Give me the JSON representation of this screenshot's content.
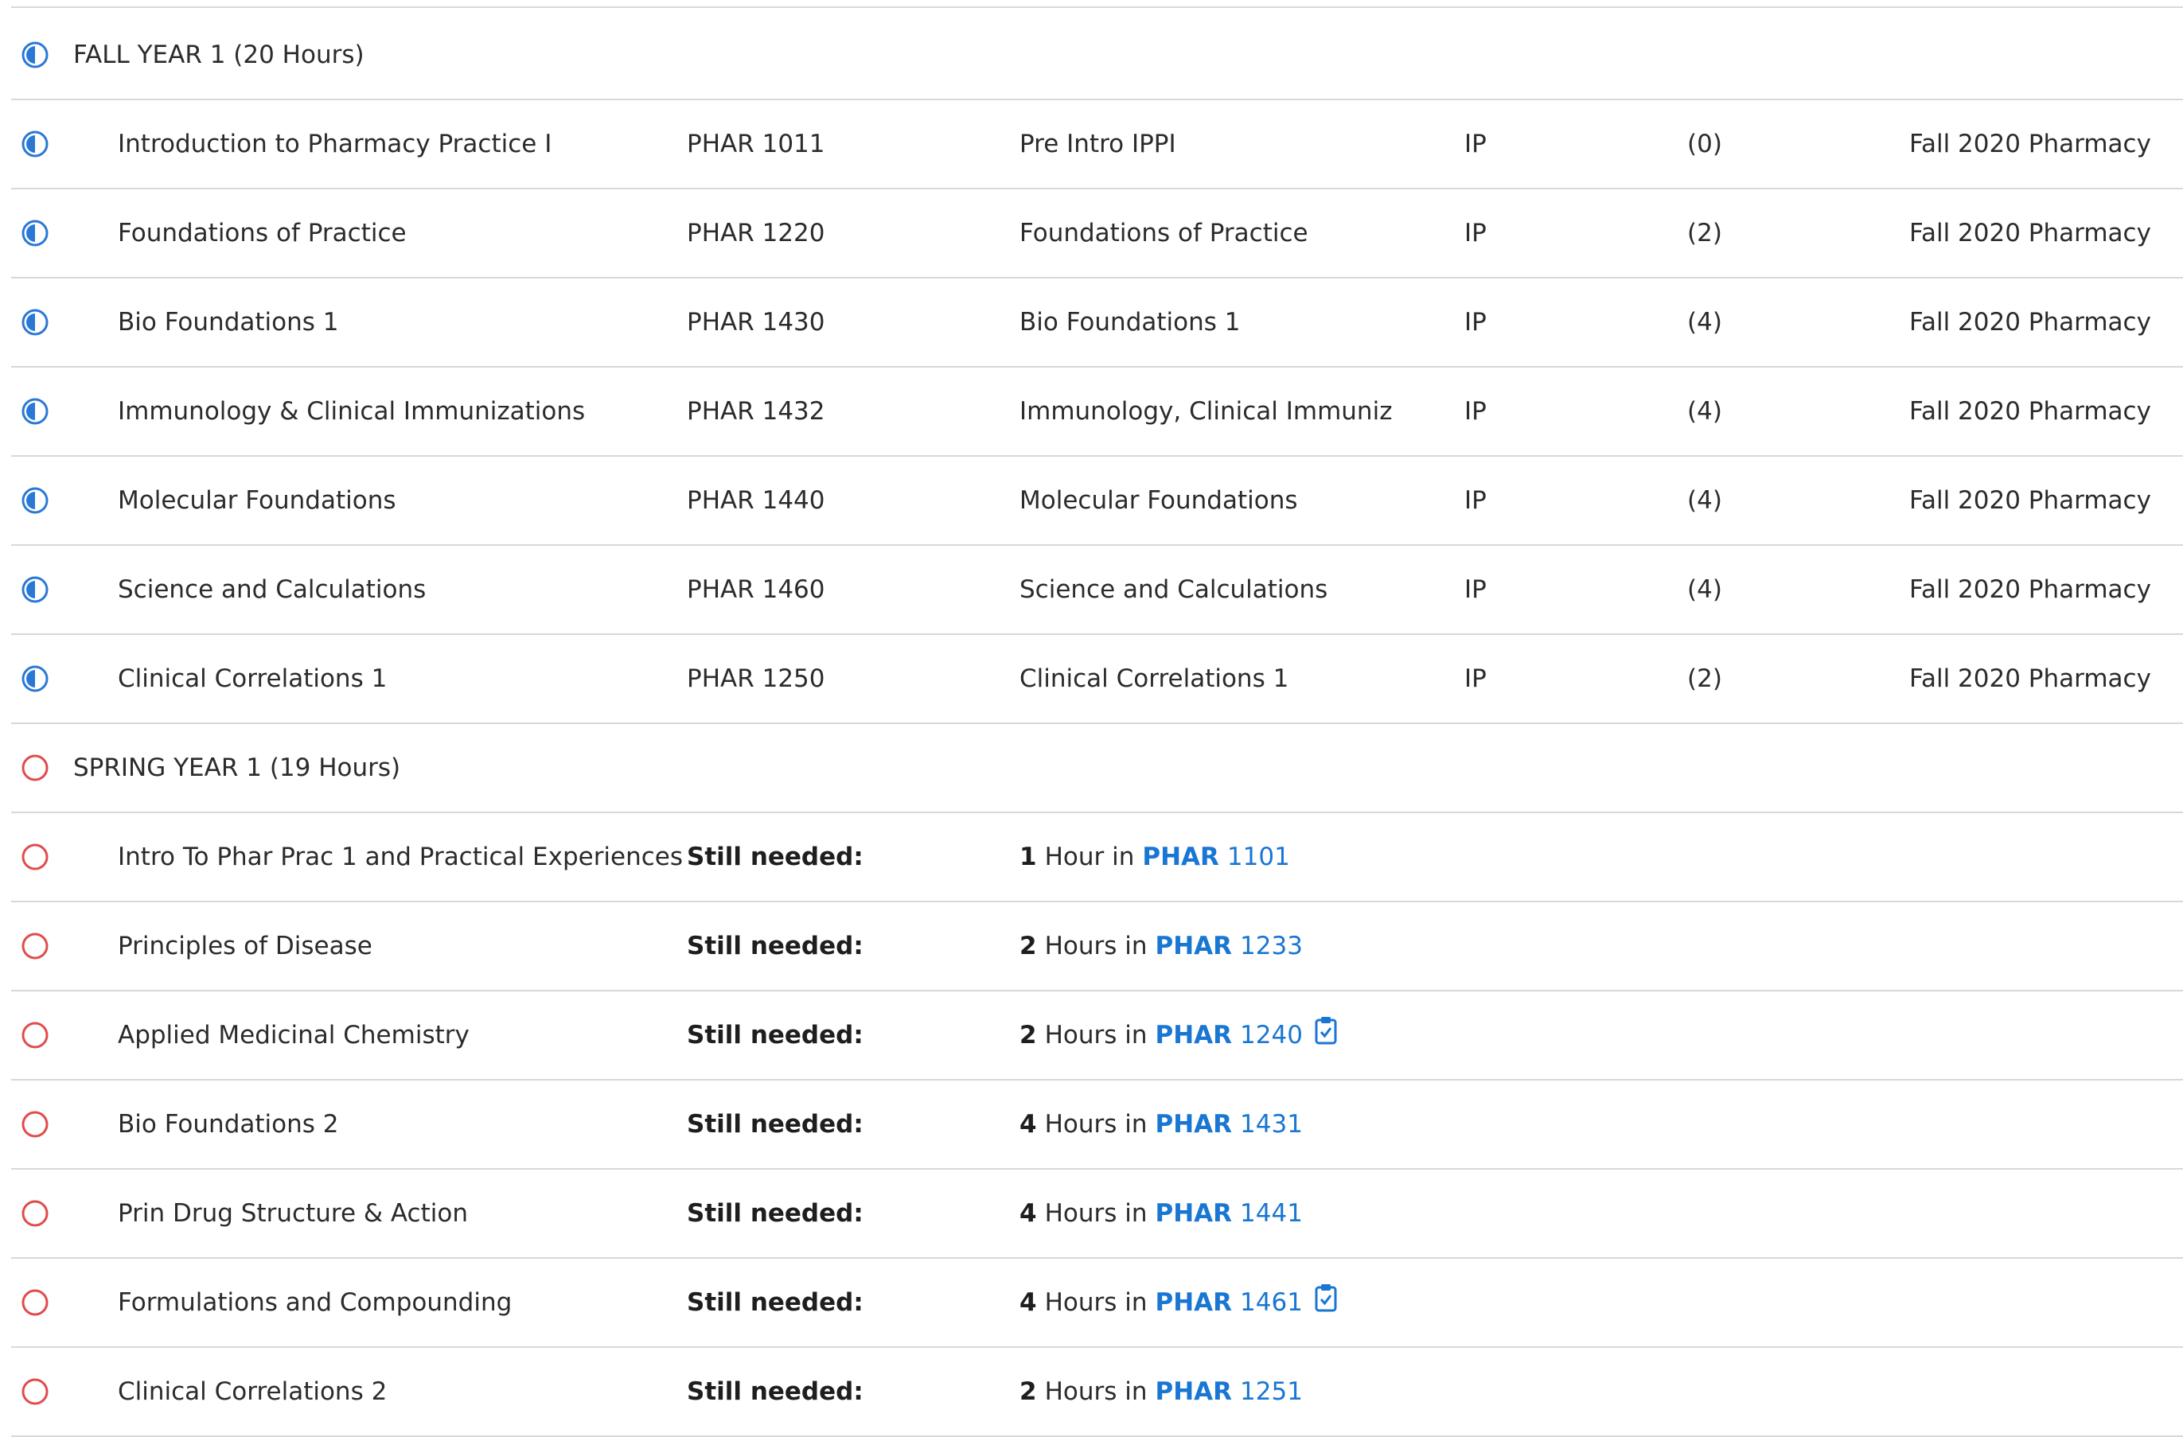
{
  "fall": {
    "header": "FALL YEAR 1 (20 Hours)",
    "status_icon": "in-progress-half-circle-icon",
    "rows": [
      {
        "title": "Introduction to Pharmacy Practice I",
        "code": "PHAR 1011",
        "name": "Pre Intro IPPI",
        "grade": "IP",
        "credits": "(0)",
        "term": "Fall 2020 Pharmacy"
      },
      {
        "title": "Foundations of Practice",
        "code": "PHAR 1220",
        "name": "Foundations of Practice",
        "grade": "IP",
        "credits": "(2)",
        "term": "Fall 2020 Pharmacy"
      },
      {
        "title": "Bio Foundations 1",
        "code": "PHAR 1430",
        "name": "Bio Foundations 1",
        "grade": "IP",
        "credits": "(4)",
        "term": "Fall 2020 Pharmacy"
      },
      {
        "title": "Immunology & Clinical Immunizations",
        "code": "PHAR 1432",
        "name": "Immunology, Clinical Immuniz",
        "grade": "IP",
        "credits": "(4)",
        "term": "Fall 2020 Pharmacy"
      },
      {
        "title": "Molecular Foundations",
        "code": "PHAR 1440",
        "name": "Molecular Foundations",
        "grade": "IP",
        "credits": "(4)",
        "term": "Fall 2020 Pharmacy"
      },
      {
        "title": "Science and Calculations",
        "code": "PHAR 1460",
        "name": "Science and Calculations",
        "grade": "IP",
        "credits": "(4)",
        "term": "Fall 2020 Pharmacy"
      },
      {
        "title": "Clinical Correlations 1",
        "code": "PHAR 1250",
        "name": "Clinical Correlations 1",
        "grade": "IP",
        "credits": "(2)",
        "term": "Fall 2020 Pharmacy"
      }
    ]
  },
  "spring": {
    "header": "SPRING YEAR 1 (19 Hours)",
    "status_icon": "not-started-circle-icon",
    "still_needed_label": "Still needed:",
    "rows": [
      {
        "title": "Intro To Phar Prac 1 and Practical Experiences",
        "num": "1",
        "unit": "Hour in",
        "subject": "PHAR",
        "course": "1101",
        "has_clipboard": false
      },
      {
        "title": "Principles of Disease",
        "num": "2",
        "unit": "Hours in",
        "subject": "PHAR",
        "course": "1233",
        "has_clipboard": false
      },
      {
        "title": "Applied Medicinal Chemistry",
        "num": "2",
        "unit": "Hours in",
        "subject": "PHAR",
        "course": "1240",
        "has_clipboard": true
      },
      {
        "title": "Bio Foundations 2",
        "num": "4",
        "unit": "Hours in",
        "subject": "PHAR",
        "course": "1431",
        "has_clipboard": false
      },
      {
        "title": "Prin Drug Structure & Action",
        "num": "4",
        "unit": "Hours in",
        "subject": "PHAR",
        "course": "1441",
        "has_clipboard": false
      },
      {
        "title": "Formulations and Compounding",
        "num": "4",
        "unit": "Hours in",
        "subject": "PHAR",
        "course": "1461",
        "has_clipboard": true
      },
      {
        "title": "Clinical Correlations 2",
        "num": "2",
        "unit": "Hours in",
        "subject": "PHAR",
        "course": "1251",
        "has_clipboard": false
      }
    ]
  },
  "colors": {
    "in_progress": "#2a78d6",
    "not_started": "#e14b4b",
    "link": "#1976d2",
    "divider": "#d8d8d8"
  }
}
